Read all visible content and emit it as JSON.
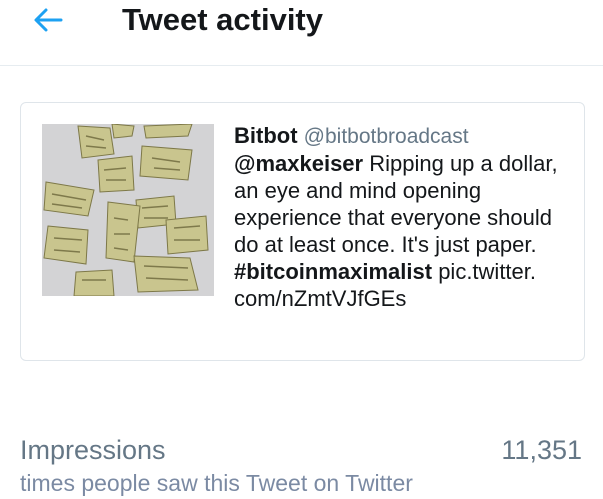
{
  "header": {
    "back_icon": "arrow-left-icon",
    "title": "Tweet activity",
    "accent_color": "#1da1f2"
  },
  "tweet": {
    "media_icon": "torn-dollar-bills-image",
    "author_name": "Bitbot",
    "author_handle": "@bitbotbroadcast",
    "mention": "@maxkeiser",
    "text_part1": " Ripping up a dollar, an eye and mind opening experience that everyone should do at least once. It's just paper. ",
    "hashtag": "#bitcoinmaximalist",
    "text_part2": " pic.twitter. com/nZmtVJfGEs"
  },
  "stats": {
    "impressions_label": "Impressions",
    "impressions_value": "11,351",
    "impressions_desc": "times people saw this Tweet on Twitter"
  }
}
